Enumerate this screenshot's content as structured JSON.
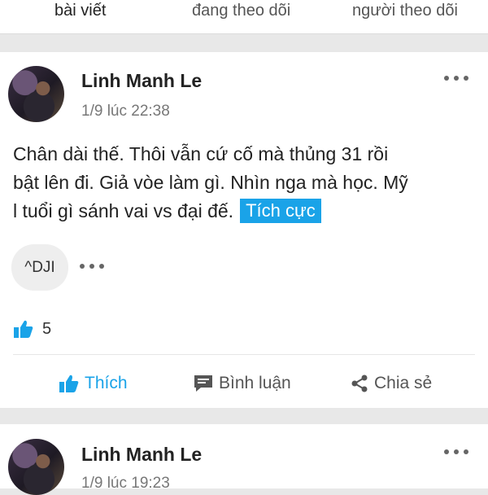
{
  "tabs": [
    {
      "label": "bài viết",
      "active": true
    },
    {
      "label": "đang theo dõi",
      "active": false
    },
    {
      "label": "người theo dõi",
      "active": false
    }
  ],
  "posts": [
    {
      "author": "Linh Manh Le",
      "time": "1/9 lúc 22:38",
      "text_lines": [
        "Chân dài thế. Thôi vẫn cứ cố mà thủng 31 rồi",
        "bật lên đi. Giả vòe làm gì. Nhìn nga mà học. Mỹ",
        "l tuổi gì sánh vai vs đại đế."
      ],
      "sentiment_tag": "Tích cực",
      "tag_chip": "^DJI",
      "likes": "5",
      "actions": {
        "like": "Thích",
        "comment": "Bình luận",
        "share": "Chia sẻ"
      }
    },
    {
      "author": "Linh Manh Le",
      "time": "1/9 lúc 19:23"
    }
  ],
  "colors": {
    "accent": "#1aa3e8",
    "background": "#e8e8e8",
    "card": "#ffffff",
    "text": "#222222",
    "muted": "#777777"
  },
  "icons": {
    "more": "more-horizontal-icon",
    "like": "thumbs-up-icon",
    "comment": "comment-icon",
    "share": "share-icon"
  }
}
